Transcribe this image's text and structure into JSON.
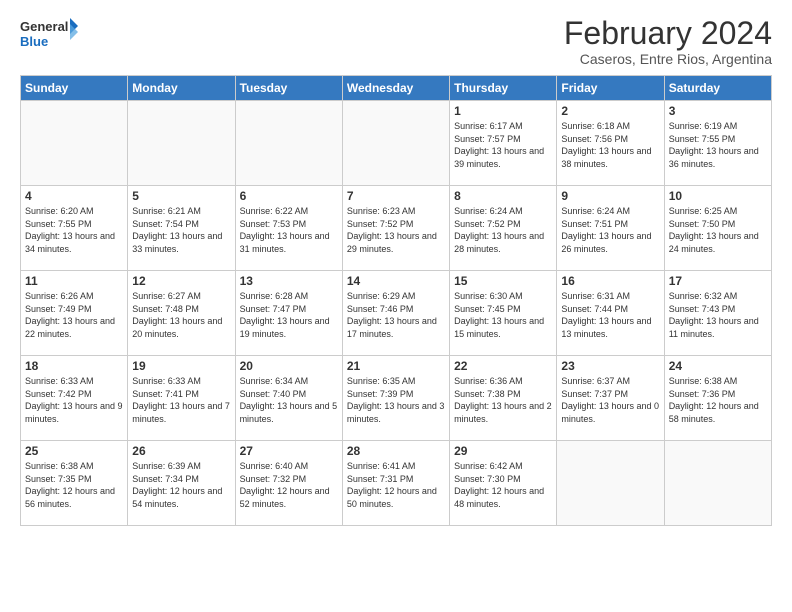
{
  "logo": {
    "general": "General",
    "blue": "Blue"
  },
  "header": {
    "title": "February 2024",
    "subtitle": "Caseros, Entre Rios, Argentina"
  },
  "weekdays": [
    "Sunday",
    "Monday",
    "Tuesday",
    "Wednesday",
    "Thursday",
    "Friday",
    "Saturday"
  ],
  "weeks": [
    [
      {
        "day": "",
        "info": ""
      },
      {
        "day": "",
        "info": ""
      },
      {
        "day": "",
        "info": ""
      },
      {
        "day": "",
        "info": ""
      },
      {
        "day": "1",
        "info": "Sunrise: 6:17 AM\nSunset: 7:57 PM\nDaylight: 13 hours and 39 minutes."
      },
      {
        "day": "2",
        "info": "Sunrise: 6:18 AM\nSunset: 7:56 PM\nDaylight: 13 hours and 38 minutes."
      },
      {
        "day": "3",
        "info": "Sunrise: 6:19 AM\nSunset: 7:55 PM\nDaylight: 13 hours and 36 minutes."
      }
    ],
    [
      {
        "day": "4",
        "info": "Sunrise: 6:20 AM\nSunset: 7:55 PM\nDaylight: 13 hours and 34 minutes."
      },
      {
        "day": "5",
        "info": "Sunrise: 6:21 AM\nSunset: 7:54 PM\nDaylight: 13 hours and 33 minutes."
      },
      {
        "day": "6",
        "info": "Sunrise: 6:22 AM\nSunset: 7:53 PM\nDaylight: 13 hours and 31 minutes."
      },
      {
        "day": "7",
        "info": "Sunrise: 6:23 AM\nSunset: 7:52 PM\nDaylight: 13 hours and 29 minutes."
      },
      {
        "day": "8",
        "info": "Sunrise: 6:24 AM\nSunset: 7:52 PM\nDaylight: 13 hours and 28 minutes."
      },
      {
        "day": "9",
        "info": "Sunrise: 6:24 AM\nSunset: 7:51 PM\nDaylight: 13 hours and 26 minutes."
      },
      {
        "day": "10",
        "info": "Sunrise: 6:25 AM\nSunset: 7:50 PM\nDaylight: 13 hours and 24 minutes."
      }
    ],
    [
      {
        "day": "11",
        "info": "Sunrise: 6:26 AM\nSunset: 7:49 PM\nDaylight: 13 hours and 22 minutes."
      },
      {
        "day": "12",
        "info": "Sunrise: 6:27 AM\nSunset: 7:48 PM\nDaylight: 13 hours and 20 minutes."
      },
      {
        "day": "13",
        "info": "Sunrise: 6:28 AM\nSunset: 7:47 PM\nDaylight: 13 hours and 19 minutes."
      },
      {
        "day": "14",
        "info": "Sunrise: 6:29 AM\nSunset: 7:46 PM\nDaylight: 13 hours and 17 minutes."
      },
      {
        "day": "15",
        "info": "Sunrise: 6:30 AM\nSunset: 7:45 PM\nDaylight: 13 hours and 15 minutes."
      },
      {
        "day": "16",
        "info": "Sunrise: 6:31 AM\nSunset: 7:44 PM\nDaylight: 13 hours and 13 minutes."
      },
      {
        "day": "17",
        "info": "Sunrise: 6:32 AM\nSunset: 7:43 PM\nDaylight: 13 hours and 11 minutes."
      }
    ],
    [
      {
        "day": "18",
        "info": "Sunrise: 6:33 AM\nSunset: 7:42 PM\nDaylight: 13 hours and 9 minutes."
      },
      {
        "day": "19",
        "info": "Sunrise: 6:33 AM\nSunset: 7:41 PM\nDaylight: 13 hours and 7 minutes."
      },
      {
        "day": "20",
        "info": "Sunrise: 6:34 AM\nSunset: 7:40 PM\nDaylight: 13 hours and 5 minutes."
      },
      {
        "day": "21",
        "info": "Sunrise: 6:35 AM\nSunset: 7:39 PM\nDaylight: 13 hours and 3 minutes."
      },
      {
        "day": "22",
        "info": "Sunrise: 6:36 AM\nSunset: 7:38 PM\nDaylight: 13 hours and 2 minutes."
      },
      {
        "day": "23",
        "info": "Sunrise: 6:37 AM\nSunset: 7:37 PM\nDaylight: 13 hours and 0 minutes."
      },
      {
        "day": "24",
        "info": "Sunrise: 6:38 AM\nSunset: 7:36 PM\nDaylight: 12 hours and 58 minutes."
      }
    ],
    [
      {
        "day": "25",
        "info": "Sunrise: 6:38 AM\nSunset: 7:35 PM\nDaylight: 12 hours and 56 minutes."
      },
      {
        "day": "26",
        "info": "Sunrise: 6:39 AM\nSunset: 7:34 PM\nDaylight: 12 hours and 54 minutes."
      },
      {
        "day": "27",
        "info": "Sunrise: 6:40 AM\nSunset: 7:32 PM\nDaylight: 12 hours and 52 minutes."
      },
      {
        "day": "28",
        "info": "Sunrise: 6:41 AM\nSunset: 7:31 PM\nDaylight: 12 hours and 50 minutes."
      },
      {
        "day": "29",
        "info": "Sunrise: 6:42 AM\nSunset: 7:30 PM\nDaylight: 12 hours and 48 minutes."
      },
      {
        "day": "",
        "info": ""
      },
      {
        "day": "",
        "info": ""
      }
    ]
  ]
}
